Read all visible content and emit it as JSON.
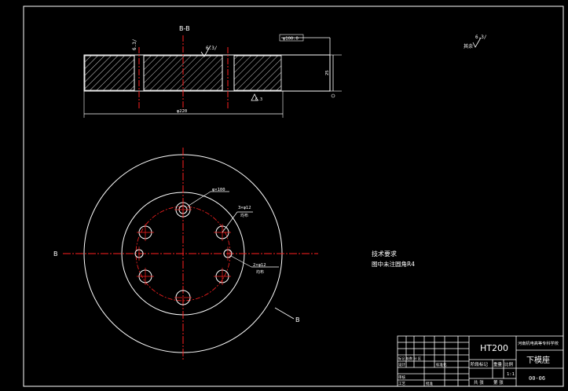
{
  "section_view": {
    "title": "B-B",
    "roughness_left": "6.3/",
    "roughness_mid": "6.3/",
    "roughness_bottom": "6.3",
    "dim_dia_top": "φ100.0",
    "dim_height": "25",
    "dim_width": "φ220"
  },
  "corner_roughness": {
    "label": "其余",
    "value": "6.3/"
  },
  "plan_view": {
    "section_mark_left": "B",
    "section_mark_right": "B",
    "note_hole_large": "φ×100",
    "note_holes_three": "3×φ12",
    "note_holes_three_sub": "均布",
    "note_holes_bottom": "2×φ12",
    "note_holes_bottom_sub": "均布"
  },
  "technical_requirements": {
    "heading": "技术要求",
    "line1": "图中未注圆角R4"
  },
  "title_block": {
    "material": "HT200",
    "part_name": "下模座",
    "drawing_no": "00-06",
    "school": "河南机电高等专科学校",
    "scale": "1:1",
    "sheet_total": "共 张",
    "sheet_no": "第 张",
    "col_stage": "阶段标记",
    "col_weight": "重量",
    "col_scale": "比例",
    "row_design": "设计",
    "row_check": "审核",
    "row_process": "工艺",
    "row_approve": "批准",
    "row_marks": "标记 处数 分 区",
    "row_std": "标准化"
  },
  "colors": {
    "background": "#000000",
    "lines": "#ffffff",
    "centerlines": "#ff2020",
    "hatch": "#ffffff"
  }
}
